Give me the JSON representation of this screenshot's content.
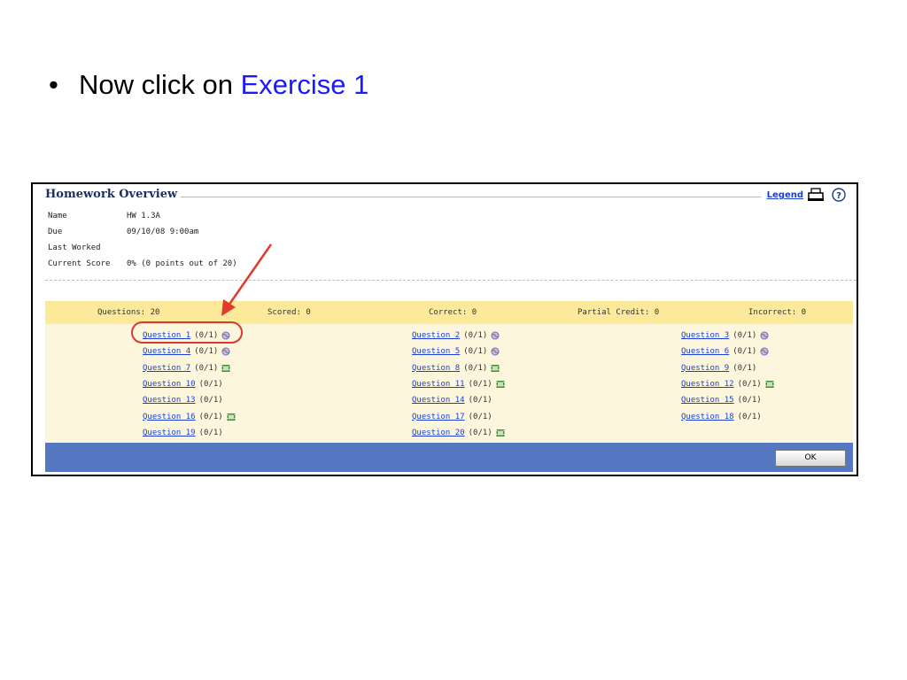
{
  "slide": {
    "bullet_char": "•",
    "instruction_prefix": "Now click on ",
    "instruction_highlight": "Exercise 1",
    "highlight_color": "#1a1aff"
  },
  "panel": {
    "title": "Homework Overview",
    "legend_link": "Legend",
    "icons": [
      "printer-icon",
      "help-icon"
    ]
  },
  "info": {
    "rows": [
      {
        "label": "Name",
        "value": "HW 1.3A"
      },
      {
        "label": "Due",
        "value": "09/10/08 9:00am"
      },
      {
        "label": "Last Worked",
        "value": ""
      },
      {
        "label": "Current Score",
        "value": "0% (0 points out of 20)"
      }
    ]
  },
  "summary": {
    "questions": "Questions: 20",
    "scored": "Scored: 0",
    "correct": "Correct: 0",
    "partial": "Partial Credit: 0",
    "incorrect": "Incorrect: 0",
    "bg_color": "#fde99a"
  },
  "questions": [
    {
      "label": "Question 1",
      "score": "(0/1)",
      "icon": "globe"
    },
    {
      "label": "Question 2",
      "score": "(0/1)",
      "icon": "globe"
    },
    {
      "label": "Question 3",
      "score": "(0/1)",
      "icon": "globe"
    },
    {
      "label": "Question 4",
      "score": "(0/1)",
      "icon": "globe"
    },
    {
      "label": "Question 5",
      "score": "(0/1)",
      "icon": "globe"
    },
    {
      "label": "Question 6",
      "score": "(0/1)",
      "icon": "globe"
    },
    {
      "label": "Question 7",
      "score": "(0/1)",
      "icon": "film"
    },
    {
      "label": "Question 8",
      "score": "(0/1)",
      "icon": "film"
    },
    {
      "label": "Question 9",
      "score": "(0/1)",
      "icon": ""
    },
    {
      "label": "Question 10",
      "score": "(0/1)",
      "icon": ""
    },
    {
      "label": "Question 11",
      "score": "(0/1)",
      "icon": "film"
    },
    {
      "label": "Question 12",
      "score": "(0/1)",
      "icon": "film"
    },
    {
      "label": "Question 13",
      "score": "(0/1)",
      "icon": ""
    },
    {
      "label": "Question 14",
      "score": "(0/1)",
      "icon": ""
    },
    {
      "label": "Question 15",
      "score": "(0/1)",
      "icon": ""
    },
    {
      "label": "Question 16",
      "score": "(0/1)",
      "icon": "film"
    },
    {
      "label": "Question 17",
      "score": "(0/1)",
      "icon": ""
    },
    {
      "label": "Question 18",
      "score": "(0/1)",
      "icon": ""
    },
    {
      "label": "Question 19",
      "score": "(0/1)",
      "icon": ""
    },
    {
      "label": "Question 20",
      "score": "(0/1)",
      "icon": "film"
    }
  ],
  "footer": {
    "ok_label": "OK",
    "bg_color": "#5577c2"
  },
  "annotation": {
    "arrow_color": "#e03a2e",
    "circle_target": "Question 1"
  }
}
